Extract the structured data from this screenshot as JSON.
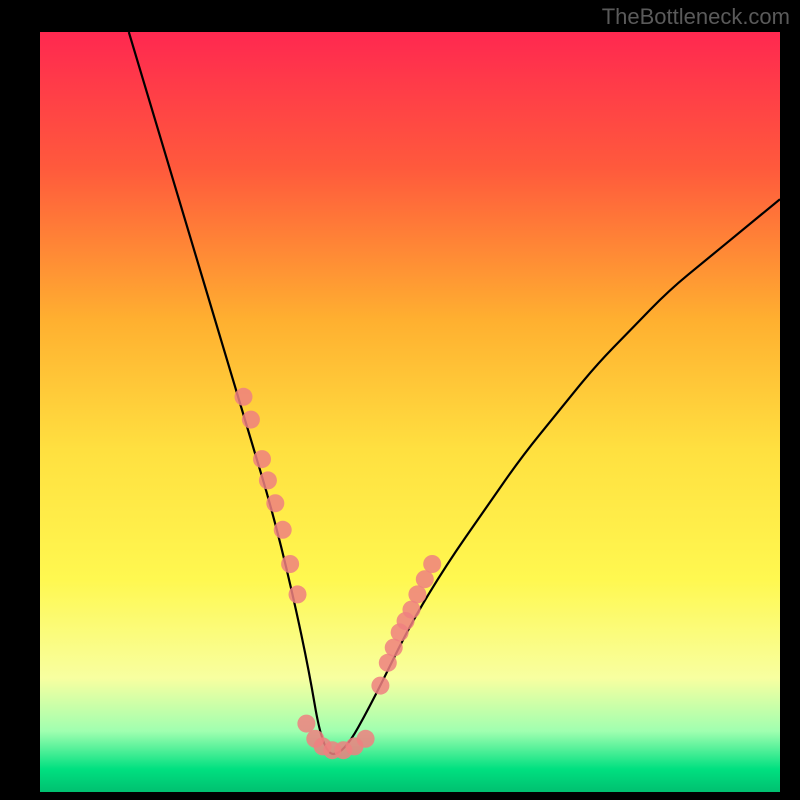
{
  "watermark": "TheBottleneck.com",
  "chart_data": {
    "type": "line",
    "title": "",
    "xlabel": "",
    "ylabel": "",
    "xlim": [
      0,
      1
    ],
    "ylim": [
      0,
      1
    ],
    "grid": false,
    "legend": false,
    "background_gradient": [
      "#ff2850",
      "#ff5a3c",
      "#ffb030",
      "#ffe040",
      "#fff850",
      "#f8ffa0",
      "#a0ffb0",
      "#00e080",
      "#00c070"
    ],
    "series": [
      {
        "name": "curve",
        "color": "#000000",
        "x": [
          0.12,
          0.16,
          0.2,
          0.24,
          0.28,
          0.32,
          0.36,
          0.3825,
          0.41,
          0.45,
          0.5,
          0.55,
          0.6,
          0.65,
          0.7,
          0.75,
          0.8,
          0.85,
          0.9,
          0.95,
          1.0
        ],
        "y": [
          1.0,
          0.87,
          0.74,
          0.61,
          0.48,
          0.35,
          0.18,
          0.05,
          0.05,
          0.12,
          0.22,
          0.3,
          0.37,
          0.44,
          0.5,
          0.56,
          0.61,
          0.66,
          0.7,
          0.74,
          0.78
        ]
      },
      {
        "name": "markers-left",
        "type": "scatter",
        "color": "#ef8080",
        "x": [
          0.275,
          0.285,
          0.3,
          0.308,
          0.318,
          0.328,
          0.338,
          0.348
        ],
        "y": [
          0.52,
          0.49,
          0.438,
          0.41,
          0.38,
          0.345,
          0.3,
          0.26
        ]
      },
      {
        "name": "markers-bottom",
        "type": "scatter",
        "color": "#ef8080",
        "x": [
          0.36,
          0.372,
          0.382,
          0.395,
          0.41,
          0.425,
          0.44
        ],
        "y": [
          0.09,
          0.07,
          0.06,
          0.055,
          0.055,
          0.06,
          0.07
        ]
      },
      {
        "name": "markers-right",
        "type": "scatter",
        "color": "#ef8080",
        "x": [
          0.46,
          0.47,
          0.478,
          0.486,
          0.494,
          0.502,
          0.51,
          0.52,
          0.53
        ],
        "y": [
          0.14,
          0.17,
          0.19,
          0.21,
          0.225,
          0.24,
          0.26,
          0.28,
          0.3
        ]
      }
    ]
  }
}
